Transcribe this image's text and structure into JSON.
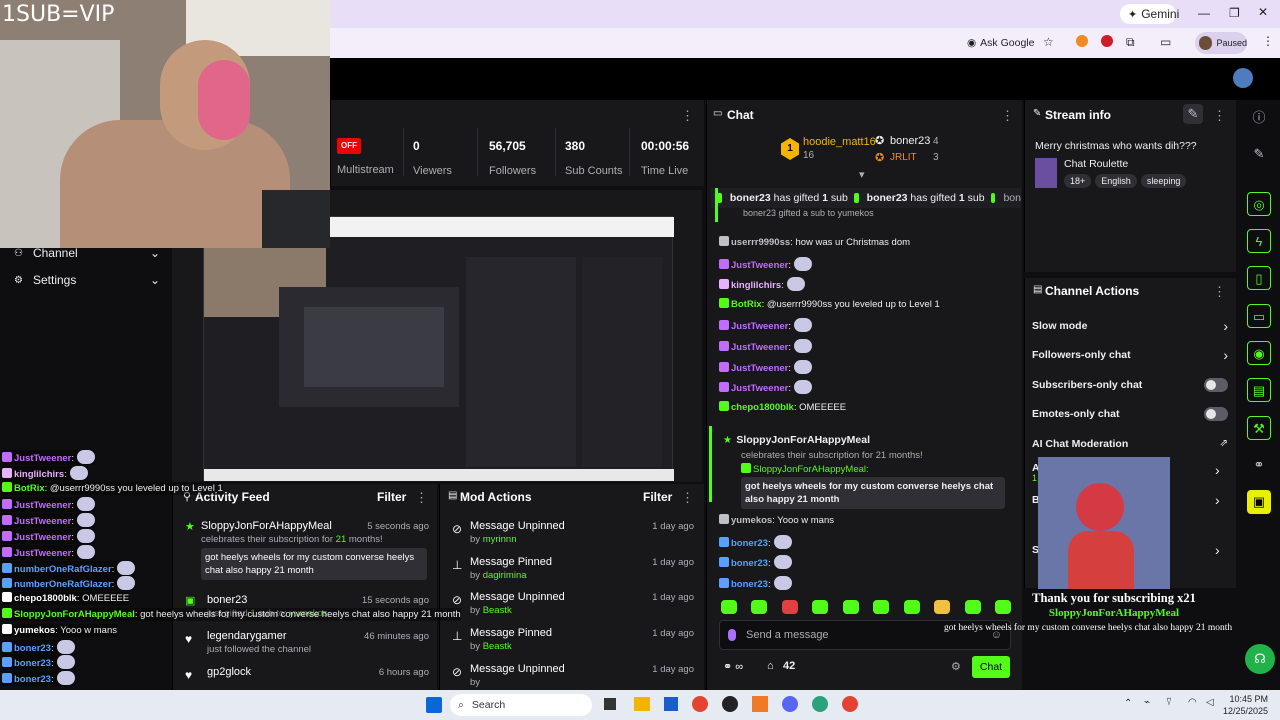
{
  "overlay_title": "1SUB=VIP",
  "browser": {
    "gemini_label": "Gemini",
    "ask_google_label": "Ask Google",
    "paused_label": "Paused"
  },
  "dashboard": {
    "stats": [
      {
        "value": "0",
        "label": "Viewers"
      },
      {
        "value": "56,705",
        "label": "Followers"
      },
      {
        "value": "380",
        "label": "Sub Counts"
      },
      {
        "value": "00:00:56",
        "label": "Time Live"
      }
    ],
    "off_badge": "OFF",
    "multistream_label": "Multistream",
    "nav": [
      {
        "label": "Channel"
      },
      {
        "label": "Settings"
      }
    ]
  },
  "activity_feed": {
    "title": "Activity Feed",
    "filter_label": "Filter",
    "items": [
      {
        "name": "SloppyJonForAHappyMeal",
        "time": "5 seconds ago",
        "desc_pre": "celebrates their subscription for ",
        "desc_num": "21",
        "desc_post": " months!",
        "message": "got heelys wheels for my custom converse heelys chat also happy 21 month"
      },
      {
        "name": "boner23",
        "time": "15 seconds ago",
        "desc_pre": "just gifted ",
        "desc_num": "1",
        "desc_post": " sub to: ",
        "desc_target": "yumekos"
      },
      {
        "name": "legendarygamer",
        "time": "46 minutes ago",
        "desc": "just followed the channel"
      },
      {
        "name": "gp2glock",
        "time": "6 hours ago"
      }
    ]
  },
  "mod_actions": {
    "title": "Mod Actions",
    "filter_label": "Filter",
    "items": [
      {
        "action": "Message Unpinned",
        "by_prefix": "by ",
        "by": "myrinnn",
        "time": "1 day ago"
      },
      {
        "action": "Message Pinned",
        "by_prefix": "by ",
        "by": "dagirimina",
        "time": "1 day ago"
      },
      {
        "action": "Message Unpinned",
        "by_prefix": "by ",
        "by": "Beastk",
        "time": "1 day ago"
      },
      {
        "action": "Message Pinned",
        "by_prefix": "by ",
        "by": "Beastk",
        "time": "1 day ago"
      },
      {
        "action": "Message Unpinned",
        "by_prefix": "by ",
        "by": "",
        "time": "1 day ago"
      }
    ]
  },
  "chat": {
    "title": "Chat",
    "leaderboard": [
      {
        "rank": "1",
        "name": "hoodie_matt16",
        "count": "16"
      },
      {
        "name": "boner23",
        "count": "4"
      },
      {
        "name": "JRLIT",
        "count": "3"
      }
    ],
    "gift_banner": [
      {
        "name": "boner23",
        "text_pre": " has gifted ",
        "num": "1",
        "text_post": " sub"
      },
      {
        "name": "boner23",
        "text_pre": " has gifted ",
        "num": "1",
        "text_post": " sub"
      },
      {
        "name": "bon"
      }
    ],
    "partial_line": "boner23 gifted a sub to yumekos",
    "messages": [
      {
        "user": "userrr9990ss",
        "text": ": how was ur Christmas dom",
        "color": "#bfbfc7"
      },
      {
        "user": "JustTweener",
        "text": ":",
        "color": "#c16bff"
      },
      {
        "user": "kinglilchirs",
        "text": ":",
        "color": "#e9b2ff"
      },
      {
        "user": "BotRix",
        "text": ": @userrr9990ss you leveled up to Level 1",
        "color": "#53fc18"
      },
      {
        "user": "JustTweener",
        "text": ":",
        "color": "#c16bff"
      },
      {
        "user": "JustTweener",
        "text": ":",
        "color": "#c16bff"
      },
      {
        "user": "JustTweener",
        "text": ":",
        "color": "#c16bff"
      },
      {
        "user": "JustTweener",
        "text": ":",
        "color": "#c16bff"
      },
      {
        "user": "chepo1800blk",
        "text": ": OMEEEEE",
        "color": "#53fc18"
      }
    ],
    "sub_card": {
      "name": "SloppyJonForAHappyMeal",
      "desc": "celebrates their subscription for 21 months!",
      "reply_user": "SloppyJonForAHappyMeal",
      "reply_text": "got heelys wheels for my custom converse heelys chat also happy 21 month"
    },
    "after": [
      {
        "user": "yumekos",
        "text": ": Yooo w mans",
        "color": "#bfbfc7"
      },
      {
        "user": "boner23",
        "text": ":",
        "color": "#5aa0ff"
      },
      {
        "user": "boner23",
        "text": ":",
        "color": "#5aa0ff"
      },
      {
        "user": "boner23",
        "text": ":",
        "color": "#5aa0ff"
      }
    ],
    "input_placeholder": "Send a message",
    "viewer_count": "42",
    "send_label": "Chat"
  },
  "stream_info": {
    "title": "Stream info",
    "stream_title": "Merry christmas who wants dih???",
    "category": "Chat Roulette",
    "tags": [
      "18+",
      "English",
      "sleeping"
    ]
  },
  "channel_actions": {
    "title": "Channel Actions",
    "items": [
      {
        "label": "Slow mode",
        "kind": "arrow"
      },
      {
        "label": "Followers-only chat",
        "kind": "arrow"
      },
      {
        "label": "Subscribers-only chat",
        "kind": "toggle"
      },
      {
        "label": "Emotes-only chat",
        "kind": "toggle"
      },
      {
        "label": "AI Chat Moderation",
        "kind": "external"
      }
    ],
    "partial_a": "A",
    "partial_a_num": "1",
    "partial_b": "B",
    "partial_s": "S"
  },
  "sub_alert": {
    "title": "Thank you for subscribing x21",
    "name": "SloppyJonForAHappyMeal",
    "message": "got heelys wheels for my custom converse heelys chat also happy 21 month"
  },
  "overlay_chat": [
    {
      "user": "JustTweener",
      "text": ":",
      "color": "#c16bff"
    },
    {
      "user": "kinglilchirs",
      "text": ":",
      "color": "#e9b2ff"
    },
    {
      "user": "BotRix",
      "text": ": @userrr9990ss you leveled up to Level 1",
      "color": "#53fc18"
    },
    {
      "user": "JustTweener",
      "text": ":",
      "color": "#c16bff"
    },
    {
      "user": "JustTweener",
      "text": ":",
      "color": "#c16bff"
    },
    {
      "user": "JustTweener",
      "text": ":",
      "color": "#c16bff"
    },
    {
      "user": "JustTweener",
      "text": ":",
      "color": "#c16bff"
    },
    {
      "user": "numberOneRafGlazer",
      "text": ":",
      "color": "#5aa0ff"
    },
    {
      "user": "numberOneRafGlazer",
      "text": ":",
      "color": "#5aa0ff"
    },
    {
      "user": "chepo1800blk",
      "text": ": OMEEEEE",
      "color": "#ffffff"
    },
    {
      "user": "SloppyJonForAHappyMeal",
      "text": ": got heelys wheels for my custom converse heelys chat also happy 21 month",
      "color": "#53fc18"
    },
    {
      "user": "yumekos",
      "text": ": Yooo w mans",
      "color": "#ffffff"
    },
    {
      "user": "boner23",
      "text": ":",
      "color": "#5aa0ff"
    },
    {
      "user": "boner23",
      "text": ":",
      "color": "#5aa0ff"
    },
    {
      "user": "boner23",
      "text": ":",
      "color": "#5aa0ff"
    }
  ],
  "taskbar": {
    "search_placeholder": "Search",
    "time": "10:45 PM",
    "date": "12/25/2025"
  },
  "colors": {
    "accent": "#53fc18",
    "panel": "#18181b",
    "off_badge": "#eb0400"
  }
}
